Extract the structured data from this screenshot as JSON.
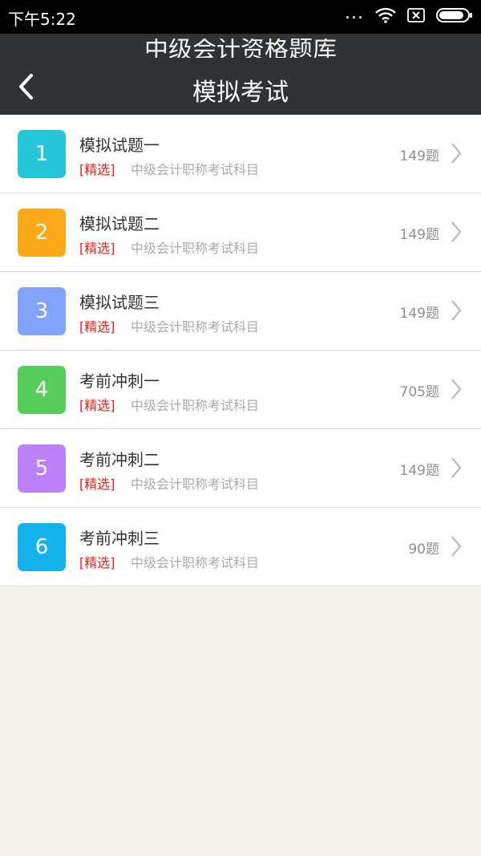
{
  "status": {
    "time": "下午5:22",
    "dots": "..."
  },
  "navbar": {
    "ghost_title": "中级会计资格题库",
    "title": "模拟考试"
  },
  "items": [
    {
      "num": "1",
      "title": "模拟试题一",
      "tag": "[精选]",
      "subject": "中级会计职称考试科目",
      "count": "149题",
      "color": "#26c6da"
    },
    {
      "num": "2",
      "title": "模拟试题二",
      "tag": "[精选]",
      "subject": "中级会计职称考试科目",
      "count": "149题",
      "color": "#fba919"
    },
    {
      "num": "3",
      "title": "模拟试题三",
      "tag": "[精选]",
      "subject": "中级会计职称考试科目",
      "count": "149题",
      "color": "#82a2fb"
    },
    {
      "num": "4",
      "title": "考前冲刺一",
      "tag": "[精选]",
      "subject": "中级会计职称考试科目",
      "count": "705题",
      "color": "#57cd5c"
    },
    {
      "num": "5",
      "title": "考前冲刺二",
      "tag": "[精选]",
      "subject": "中级会计职称考试科目",
      "count": "149题",
      "color": "#bb82f8"
    },
    {
      "num": "6",
      "title": "考前冲刺三",
      "tag": "[精选]",
      "subject": "中级会计职称考试科目",
      "count": "90题",
      "color": "#14b3ec"
    }
  ]
}
